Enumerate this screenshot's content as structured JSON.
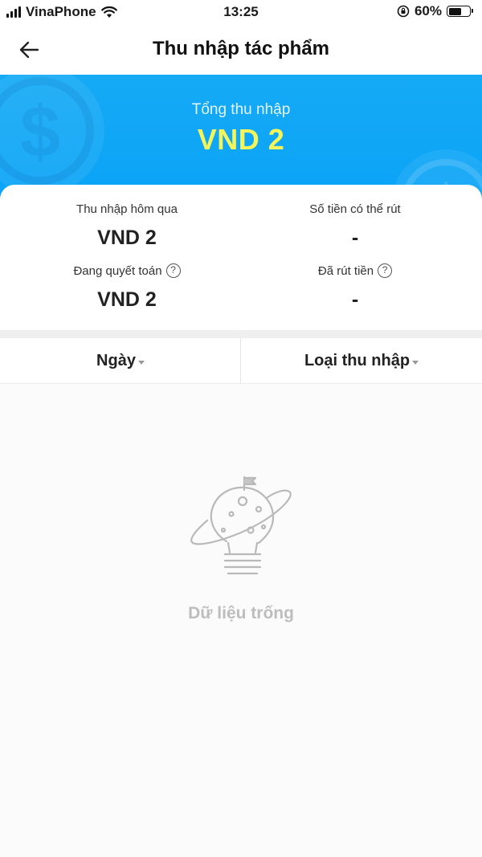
{
  "status_bar": {
    "carrier": "VinaPhone",
    "time": "13:25",
    "battery_percent": "60%",
    "battery_level": 0.6
  },
  "nav": {
    "title": "Thu nhập tác phẩm",
    "back_icon": "arrow-left-icon"
  },
  "hero": {
    "label": "Tổng thu nhập",
    "amount": "VND 2",
    "background_color": "#0aa3f7",
    "amount_color": "#f3f55a"
  },
  "stats": {
    "yesterday": {
      "label": "Thu nhập hôm qua",
      "value": "VND 2"
    },
    "withdrawable": {
      "label": "Số tiền có thể rút",
      "value": "-"
    },
    "settling": {
      "label": "Đang quyết toán",
      "value": "VND 2",
      "help": "?"
    },
    "withdrawn": {
      "label": "Đã rút tiền",
      "value": "-",
      "help": "?"
    }
  },
  "filters": {
    "date": "Ngày",
    "income_type": "Loại thu nhập"
  },
  "empty_state": {
    "text": "Dữ liệu trống",
    "icon": "planet-lightbulb-icon"
  }
}
